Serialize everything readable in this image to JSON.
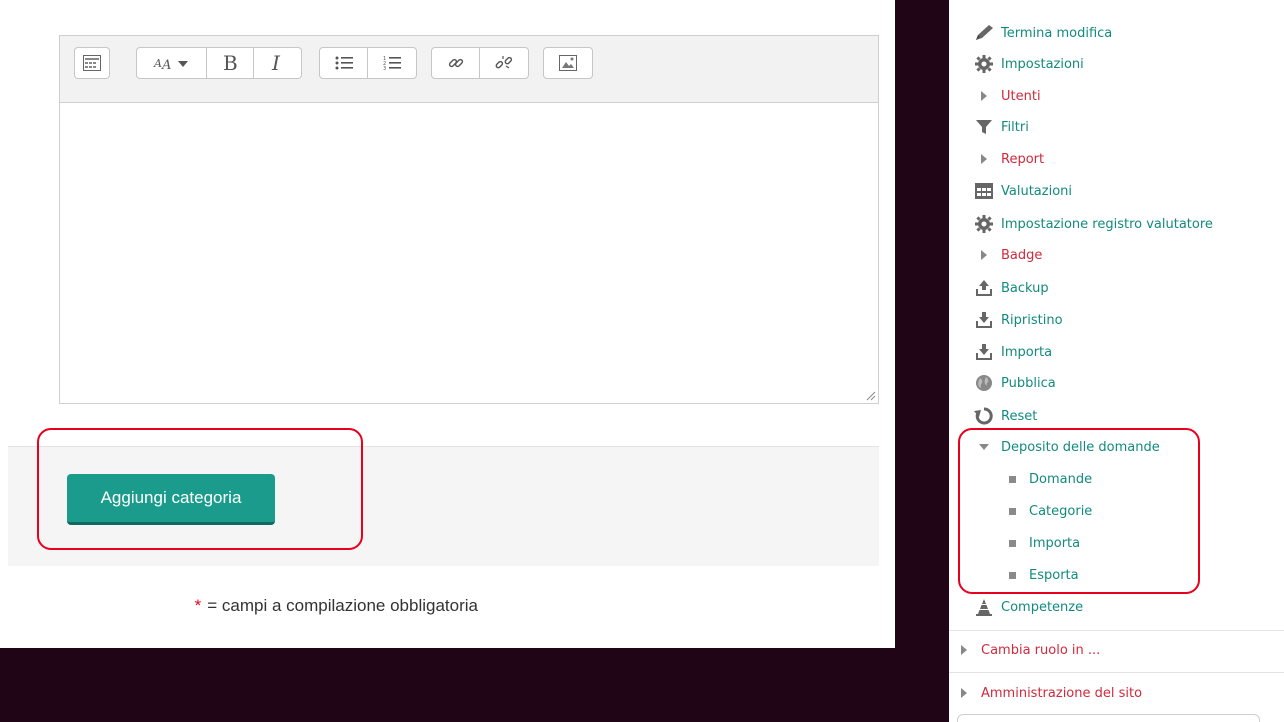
{
  "form": {
    "submit_label": "Aggiungi categoria",
    "required_star": "*",
    "required_text": "= campi a compilazione obbligatoria"
  },
  "editor": {
    "toolbar_icons": [
      "toolbar-toggle",
      "font-style",
      "bold",
      "italic",
      "unordered-list",
      "ordered-list",
      "link",
      "unlink",
      "image"
    ]
  },
  "sidebar": {
    "items": [
      {
        "label": "Termina modifica",
        "icon": "pencil-icon",
        "color": "teal"
      },
      {
        "label": "Impostazioni",
        "icon": "gear-icon",
        "color": "teal"
      },
      {
        "label": "Utenti",
        "icon": "caret-right-icon",
        "color": "red"
      },
      {
        "label": "Filtri",
        "icon": "funnel-icon",
        "color": "teal"
      },
      {
        "label": "Report",
        "icon": "caret-right-icon",
        "color": "red"
      },
      {
        "label": "Valutazioni",
        "icon": "table-icon",
        "color": "teal"
      },
      {
        "label": "Impostazione registro valutatore",
        "icon": "gear-icon",
        "color": "teal"
      },
      {
        "label": "Badge",
        "icon": "caret-right-icon",
        "color": "red"
      },
      {
        "label": "Backup",
        "icon": "upload-icon",
        "color": "teal"
      },
      {
        "label": "Ripristino",
        "icon": "download-icon",
        "color": "teal"
      },
      {
        "label": "Importa",
        "icon": "download-icon",
        "color": "teal"
      },
      {
        "label": "Pubblica",
        "icon": "globe-icon",
        "color": "teal"
      },
      {
        "label": "Reset",
        "icon": "refresh-icon",
        "color": "teal"
      },
      {
        "label": "Deposito delle domande",
        "icon": "caret-down-icon",
        "color": "teal"
      },
      {
        "label": "Domande",
        "icon": "bullet-icon",
        "color": "teal"
      },
      {
        "label": "Categorie",
        "icon": "bullet-icon",
        "color": "teal"
      },
      {
        "label": "Importa",
        "icon": "bullet-icon",
        "color": "teal"
      },
      {
        "label": "Esporta",
        "icon": "bullet-icon",
        "color": "teal"
      },
      {
        "label": "Competenze",
        "icon": "competency-icon",
        "color": "teal"
      }
    ],
    "switch_role": "Cambia ruolo in ...",
    "site_admin": "Amministrazione del sito"
  },
  "colors": {
    "teal": "#128a7f",
    "red": "#cf2a3c",
    "button": "#1a9b8c",
    "annotation": "#e8001c",
    "background": "#1f0515"
  }
}
